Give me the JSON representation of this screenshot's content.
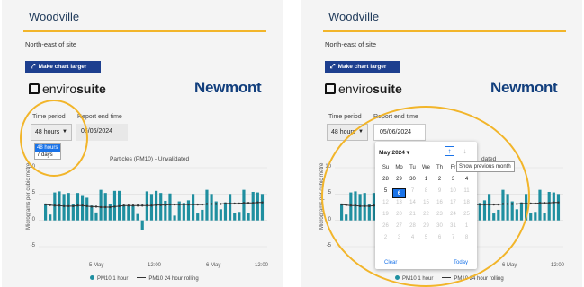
{
  "panels": [
    {
      "title": "Woodville",
      "site": "North-east of site",
      "button_label": "Make chart larger",
      "logo_left": "enviro",
      "logo_bold": "suite",
      "brand": "Newmont",
      "time_period_label": "Time period",
      "time_period_value": "48 hours",
      "report_end_label": "Report end time",
      "report_end_value": "05/06/2024",
      "dropdown_options": [
        "48 hours",
        "7 days"
      ],
      "chart_title": "Particles (PM10) - Unvalidated"
    },
    {
      "title": "Woodville",
      "site": "North-east of site",
      "button_label": "Make chart larger",
      "logo_left": "enviro",
      "logo_bold": "suite",
      "brand": "Newmont",
      "time_period_label": "Time period",
      "time_period_value": "48 hours",
      "report_end_label": "Report end time",
      "report_end_value": "05/06/2024",
      "chart_title_partial": "dated"
    }
  ],
  "calendar": {
    "month_label": "May 2024",
    "month_caret": "▾",
    "nav_prev_icon": "arrow-up-icon",
    "nav_next_icon": "arrow-down-icon",
    "tooltip": "Show previous month",
    "weekdays": [
      "Su",
      "Mo",
      "Tu",
      "We",
      "Th",
      "Fr",
      "Sa"
    ],
    "weeks": [
      [
        "28",
        "29",
        "30",
        "1",
        "2",
        "3",
        "4"
      ],
      [
        "5",
        "6",
        "7",
        "8",
        "9",
        "10",
        "11"
      ],
      [
        "12",
        "13",
        "14",
        "15",
        "16",
        "17",
        "18"
      ],
      [
        "19",
        "20",
        "21",
        "22",
        "23",
        "24",
        "25"
      ],
      [
        "26",
        "27",
        "28",
        "29",
        "30",
        "31",
        "1"
      ],
      [
        "2",
        "3",
        "4",
        "5",
        "6",
        "7",
        "8"
      ]
    ],
    "selected_day": "6",
    "clear_label": "Clear",
    "today_label": "Today"
  },
  "chart_data": {
    "type": "bar",
    "ylabel": "Micrograms per cubic metre",
    "yticks": [
      "10",
      "5",
      "0",
      "-5"
    ],
    "ylim": [
      -5,
      10
    ],
    "xticks": [
      "5 May",
      "12:00",
      "6 May",
      "12:00"
    ],
    "series": [
      {
        "name": "PM10 1 hour",
        "values": [
          3.2,
          1.1,
          5.3,
          5.5,
          5.0,
          5.2,
          3.0,
          5.2,
          4.8,
          4.3,
          2.8,
          1.5,
          5.8,
          5.2,
          3.1,
          5.6,
          5.6,
          2.9,
          2.8,
          2.8,
          1.2,
          -1.8,
          5.5,
          5.0,
          5.6,
          5.2,
          3.7,
          5.1,
          0.9,
          3.6,
          3.3,
          3.8,
          5.0,
          1.3,
          2.0,
          5.8,
          5.0,
          3.6,
          2.1,
          3.4,
          5.0,
          1.4,
          1.6,
          5.8,
          1.4,
          5.4,
          5.3,
          5.0
        ]
      },
      {
        "name": "PM10 24 hour rolling",
        "values": [
          3.0,
          2.9,
          2.8,
          2.8,
          2.7,
          2.7,
          2.7,
          2.8,
          2.8,
          2.7,
          2.6,
          2.6,
          2.5,
          2.5,
          2.5,
          2.6,
          2.7,
          2.8,
          2.8,
          2.8,
          2.8,
          2.8,
          2.8,
          2.8,
          2.9,
          2.9,
          2.9,
          3.0,
          3.0,
          3.0,
          3.0,
          3.0,
          3.0,
          3.0,
          3.0,
          3.1,
          3.1,
          3.1,
          3.1,
          3.2,
          3.2,
          3.2,
          3.2,
          3.3,
          3.3,
          3.3,
          3.4,
          3.4
        ]
      }
    ]
  },
  "colors": {
    "accent": "#f2b52a",
    "button": "#1d3f8f",
    "brand": "#123f7d",
    "bar": "#1f8fa0",
    "line": "#333333",
    "calendar_selected": "#1a73e8"
  }
}
